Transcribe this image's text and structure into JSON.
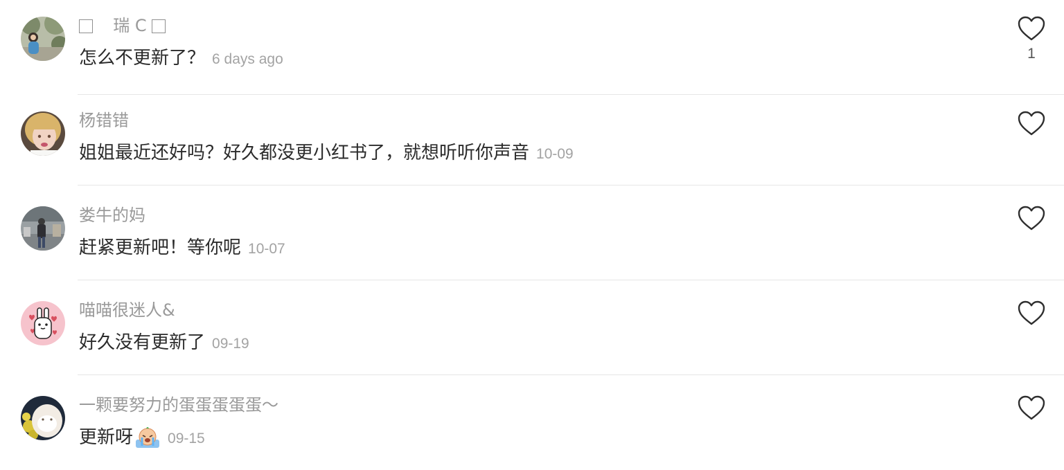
{
  "comments": [
    {
      "username_box_left": "□",
      "username": "瑞 C",
      "username_box_right": "□",
      "text": "怎么不更新了？",
      "time": "6 days ago",
      "likes": "1",
      "avatar": "photo-outdoor-trees"
    },
    {
      "username": "杨错错",
      "text": "姐姐最近还好吗？好久都没更小红书了，就想听听你声音",
      "time": "10-09",
      "avatar": "photo-blonde-child"
    },
    {
      "username": "娄牛的妈",
      "text": "赶紧更新吧！等你呢",
      "time": "10-07",
      "avatar": "photo-street-person"
    },
    {
      "username": "喵喵很迷人&",
      "text": "好久没有更新了",
      "time": "09-19",
      "avatar": "cartoon-bunny-pink"
    },
    {
      "username": "一颗要努力的蛋蛋蛋蛋蛋～",
      "text": "更新呀",
      "emoji": "crying-face-emoji",
      "time": "09-15",
      "avatar": "photo-plush-yellow-flowers"
    }
  ],
  "icons": {
    "like": "heart-outline-icon"
  },
  "colors": {
    "username": "#9a9a9a",
    "text": "#2b2b2b",
    "timestamp": "#a3a3a3",
    "divider": "#e6e6e6"
  }
}
